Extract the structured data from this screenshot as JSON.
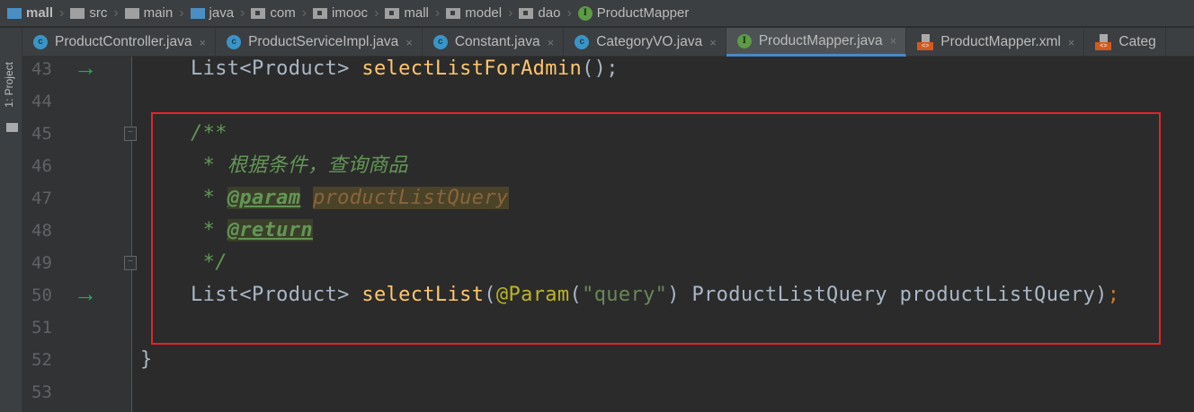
{
  "breadcrumb": [
    "mall",
    "src",
    "main",
    "java",
    "com",
    "imooc",
    "mall",
    "model",
    "dao",
    "ProductMapper"
  ],
  "side_tool": {
    "label": "1: Project"
  },
  "tabs": [
    {
      "label": "ProductController.java",
      "icon": "class-icon",
      "active": false
    },
    {
      "label": "ProductServiceImpl.java",
      "icon": "class-icon",
      "active": false
    },
    {
      "label": "Constant.java",
      "icon": "class-icon",
      "active": false
    },
    {
      "label": "CategoryVO.java",
      "icon": "class-icon",
      "active": false
    },
    {
      "label": "ProductMapper.java",
      "icon": "interface-icon",
      "active": true
    },
    {
      "label": "ProductMapper.xml",
      "icon": "xml-icon",
      "active": false
    },
    {
      "label": "Categ",
      "icon": "xml-icon",
      "active": false
    }
  ],
  "close_glyph": "×",
  "line_numbers": [
    "43",
    "44",
    "45",
    "46",
    "47",
    "48",
    "49",
    "50",
    "51",
    "52",
    "53"
  ],
  "code": {
    "l43_type": "List<Product> ",
    "l43_fn": "selectListForAdmin",
    "l43_end": "();",
    "l45": "/**",
    "l46": " * 根据条件，查询商品",
    "l47_star": " * ",
    "l47_tag": "@param",
    "l47_val": "productListQuery",
    "l48_star": " * ",
    "l48_tag": "@return",
    "l49": " */",
    "l50_type": "List<Product> ",
    "l50_fn": "selectList",
    "l50_p": "(",
    "l50_an": "@Param",
    "l50_p2": "(",
    "l50_str": "\"query\"",
    "l50_rest": ") ProductListQuery productListQuery)",
    "l50_semi": ";",
    "l52": "}"
  }
}
